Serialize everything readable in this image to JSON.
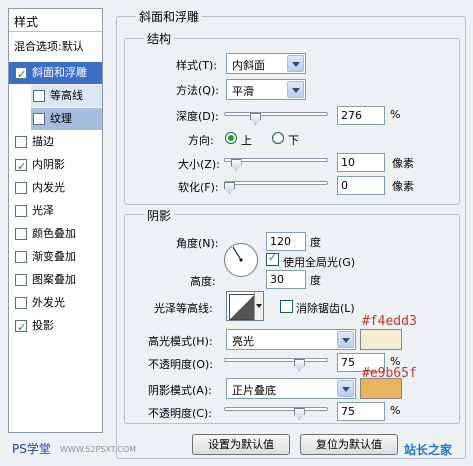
{
  "left_panel": {
    "title": "样式",
    "items": [
      {
        "label": "混合选项:默认",
        "checkbox": false
      },
      {
        "label": "斜面和浮雕",
        "checkbox": true,
        "checked": true,
        "selected": true
      },
      {
        "label": "等高线",
        "checkbox": true,
        "checked": false,
        "sub": true
      },
      {
        "label": "纹理",
        "checkbox": true,
        "checked": false,
        "sub": true
      },
      {
        "label": "描边",
        "checkbox": true,
        "checked": false
      },
      {
        "label": "内阴影",
        "checkbox": true,
        "checked": true
      },
      {
        "label": "内发光",
        "checkbox": true,
        "checked": false
      },
      {
        "label": "光泽",
        "checkbox": true,
        "checked": false
      },
      {
        "label": "颜色叠加",
        "checkbox": true,
        "checked": false
      },
      {
        "label": "渐变叠加",
        "checkbox": true,
        "checked": false
      },
      {
        "label": "图案叠加",
        "checkbox": true,
        "checked": false
      },
      {
        "label": "外发光",
        "checkbox": true,
        "checked": false
      },
      {
        "label": "投影",
        "checkbox": true,
        "checked": true
      }
    ]
  },
  "bevel": {
    "group_title": "斜面和浮雕",
    "structure": {
      "title": "结构",
      "style_label": "样式(T):",
      "style_value": "内斜面",
      "technique_label": "方法(Q):",
      "technique_value": "平滑",
      "depth_label": "深度(D):",
      "depth_value": "276",
      "depth_unit": "%",
      "depth_level": 0.28,
      "direction_label": "方向:",
      "direction_up": "上",
      "direction_down": "下",
      "direction_selected": "上",
      "size_label": "大小(Z):",
      "size_value": "10",
      "size_unit": "像素",
      "size_level": 0.07,
      "soften_label": "软化(F):",
      "soften_value": "0",
      "soften_unit": "像素",
      "soften_level": 0.0
    },
    "shading": {
      "title": "阴影",
      "angle_label": "角度(N):",
      "angle_value": "120",
      "angle_unit": "度",
      "global_light_label": "使用全局光(G)",
      "global_light_checked": true,
      "altitude_label": "高度:",
      "altitude_value": "30",
      "altitude_unit": "度",
      "gloss_contour_label": "光泽等高线:",
      "anti_aliased_label": "消除锯齿(L)",
      "anti_aliased_checked": false,
      "highlight_mode_label": "高光模式(H):",
      "highlight_mode_value": "亮光",
      "highlight_color": "#f4edd3",
      "highlight_hex_note": "#f4edd3",
      "highlight_opacity_label": "不透明度(O):",
      "highlight_opacity_value": "75",
      "highlight_opacity_unit": "%",
      "highlight_opacity_level": 0.75,
      "shadow_mode_label": "阴影模式(A):",
      "shadow_mode_value": "正片叠底",
      "shadow_color": "#e9b65f",
      "shadow_hex_note": "#e9b65f",
      "shadow_opacity_label": "不透明度(C):",
      "shadow_opacity_value": "75",
      "shadow_opacity_unit": "%",
      "shadow_opacity_level": 0.75
    },
    "buttons": {
      "make_default": "设置为默认值",
      "reset_default": "复位为默认值"
    }
  },
  "watermarks": {
    "left": "PS学堂",
    "left_url": "WWW.52PSXT.COM",
    "right": "站长之家"
  },
  "colors": {
    "accent": "#3b6ec9",
    "hex_note": "#c0392b"
  }
}
